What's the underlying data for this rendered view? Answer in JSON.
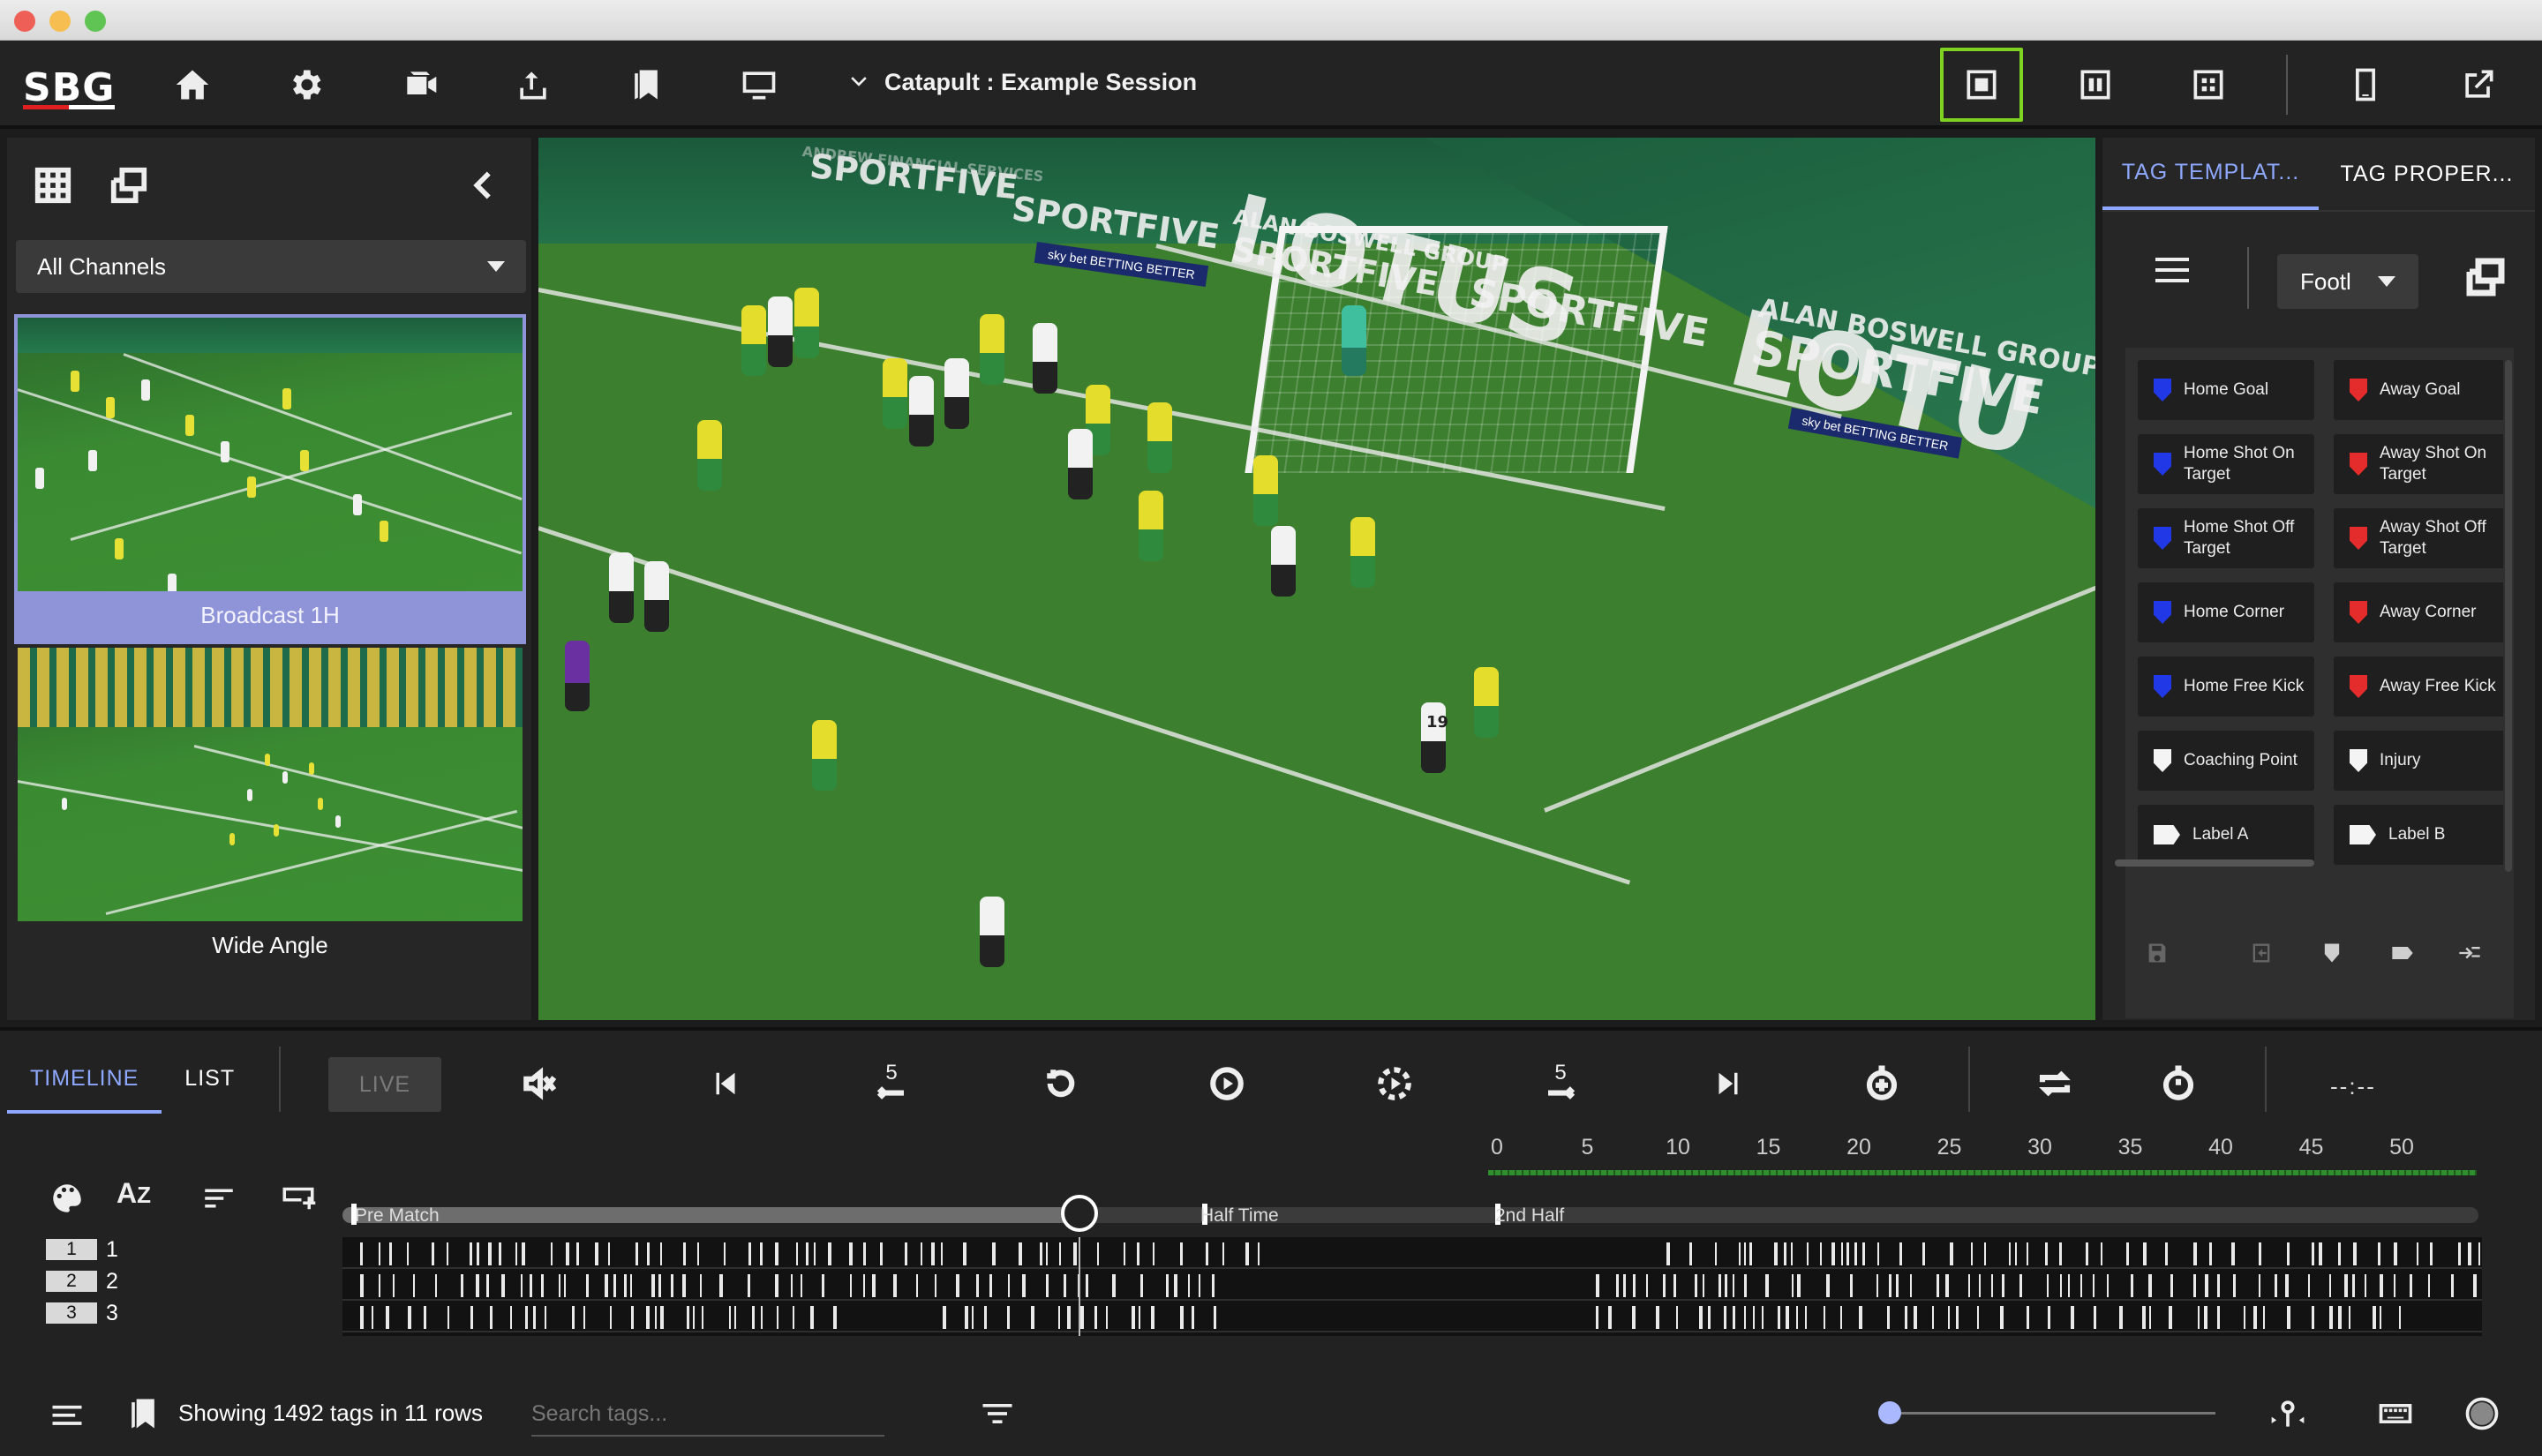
{
  "app": {
    "logo": "SBG",
    "session_title": "Catapult : Example Session"
  },
  "left_panel": {
    "channel_select": "All Channels",
    "channels": [
      {
        "label": "Broadcast 1H",
        "selected": true
      },
      {
        "label": "Wide Angle",
        "selected": false
      }
    ]
  },
  "video": {
    "boards": [
      "LOTUS",
      "LOTU",
      "SPORTFIVE",
      "SPORTFIVE",
      "SPORTFIVE",
      "SPORTFIVE",
      "SPORTFIVE",
      "ALAN BOSWELL GROUP",
      "ALAN BOSWELL GROUP",
      "sky bet BETTING BETTER",
      "sky bet BETTING BETTER",
      "ANDREW FINANCIAL SERVICES"
    ],
    "player_number": "19"
  },
  "right_panel": {
    "tabs": [
      "TAG TEMPLAT...",
      "TAG PROPER..."
    ],
    "active_tab": 0,
    "template_select": "Footl",
    "tags": [
      {
        "label": "Home Goal",
        "color": "#2138e6",
        "shape": "shield"
      },
      {
        "label": "Away Goal",
        "color": "#e42c2c",
        "shape": "shield"
      },
      {
        "label": "Home Shot On Target",
        "color": "#2138e6",
        "shape": "shield"
      },
      {
        "label": "Away Shot On Target",
        "color": "#e42c2c",
        "shape": "shield"
      },
      {
        "label": "Home Shot Off Target",
        "color": "#2138e6",
        "shape": "shield"
      },
      {
        "label": "Away Shot Off Target",
        "color": "#e42c2c",
        "shape": "shield"
      },
      {
        "label": "Home Corner",
        "color": "#2138e6",
        "shape": "shield"
      },
      {
        "label": "Away Corner",
        "color": "#e42c2c",
        "shape": "shield"
      },
      {
        "label": "Home Free Kick",
        "color": "#2138e6",
        "shape": "shield"
      },
      {
        "label": "Away Free Kick",
        "color": "#e42c2c",
        "shape": "shield"
      },
      {
        "label": "Coaching Point",
        "color": "#f4f4f4",
        "shape": "shield"
      },
      {
        "label": "Injury",
        "color": "#f4f4f4",
        "shape": "shield"
      },
      {
        "label": "Label A",
        "color": "#f4f4f4",
        "shape": "label"
      },
      {
        "label": "Label B",
        "color": "#f4f4f4",
        "shape": "label"
      }
    ]
  },
  "bottom": {
    "tabs": [
      "TIMELINE",
      "LIST"
    ],
    "active_tab": 0,
    "live_label": "LIVE",
    "skip_back_label": "5",
    "skip_fwd_label": "5",
    "time_display": "--:--",
    "ruler_ticks": [
      "0",
      "5",
      "10",
      "15",
      "20",
      "25",
      "30",
      "35",
      "40",
      "45",
      "50"
    ],
    "periods": [
      "Pre Match",
      "Half Time",
      "2nd Half"
    ],
    "rows": [
      {
        "badge": "1",
        "label": "1"
      },
      {
        "badge": "2",
        "label": "2"
      },
      {
        "badge": "3",
        "label": "3"
      }
    ],
    "status_text": "Showing 1492 tags in 11 rows",
    "search_placeholder": "Search tags..."
  },
  "colors": {
    "accent": "#8fa8ff",
    "active_view_border": "#7ed321",
    "home": "#2138e6",
    "away": "#e42c2c"
  }
}
